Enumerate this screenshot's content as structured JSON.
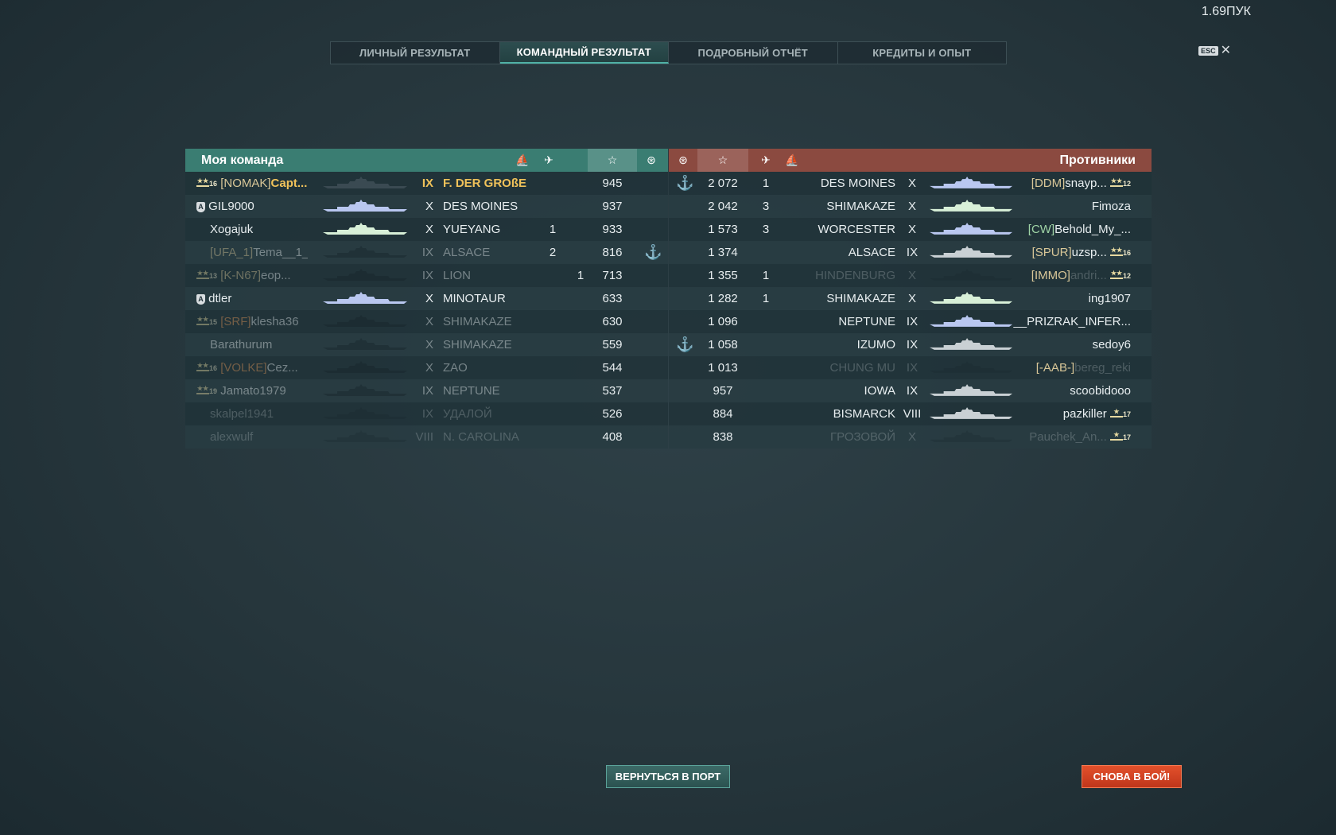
{
  "version": "1.69ПУК",
  "tabs": [
    {
      "label": "ЛИЧНЫЙ РЕЗУЛЬТАТ",
      "active": false
    },
    {
      "label": "КОМАНДНЫЙ РЕЗУЛЬТАТ",
      "active": true
    },
    {
      "label": "ПОДРОБНЫЙ ОТЧЁТ",
      "active": false
    },
    {
      "label": "КРЕДИТЫ И ОПЫТ",
      "active": false
    }
  ],
  "esc": {
    "key": "ESC",
    "close": "✕"
  },
  "my_team": {
    "title": "Моя команда",
    "header_icons": [
      "ship-sunk-icon",
      "aircraft-destroyed-icon",
      "star-icon",
      "base-capture-icon"
    ],
    "rows": [
      {
        "rank": "16",
        "rank_icon": "stripes-2",
        "clan": "[NOMAK]",
        "name": "Capt...",
        "tier": "IX",
        "ship": "F. DER GROßE",
        "planes": "",
        "kills": "",
        "xp": "945",
        "cap": "",
        "highlight": true,
        "state": "alive",
        "ship_color": "#3a4a52"
      },
      {
        "division": "A",
        "clan": "",
        "name": "GIL9000",
        "tier": "X",
        "ship": "DES MOINES",
        "planes": "",
        "kills": "",
        "xp": "937",
        "cap": "",
        "state": "alive",
        "ship_color": "#b9c7f0"
      },
      {
        "clan": "",
        "name": "Xogajuk",
        "tier": "X",
        "ship": "YUEYANG",
        "planes": "1",
        "kills": "",
        "xp": "933",
        "cap": "",
        "state": "alive",
        "ship_color": "#d8f0d8"
      },
      {
        "clan": "[UFA_1]",
        "name": "Tema__1___",
        "tier": "IX",
        "ship": "ALSACE",
        "planes": "2",
        "kills": "",
        "xp": "816",
        "cap": "anchor",
        "state": "dead",
        "ship_color": "#16242a"
      },
      {
        "rank": "13",
        "rank_icon": "stripes-2",
        "clan": "[K-N67]",
        "name": "eop...",
        "tier": "IX",
        "ship": "LION",
        "planes": "",
        "kills": "1",
        "xp": "713",
        "cap": "",
        "state": "dead",
        "ship_color": "#16242a"
      },
      {
        "division": "A",
        "clan": "",
        "name": "dtler",
        "tier": "X",
        "ship": "MINOTAUR",
        "planes": "",
        "kills": "",
        "xp": "633",
        "cap": "",
        "state": "alive",
        "ship_color": "#b9c7f0"
      },
      {
        "rank": "15",
        "rank_icon": "stripes-2",
        "clan": "[SRF]",
        "clan_color": "orange",
        "name": "klesha36",
        "tier": "X",
        "ship": "SHIMAKAZE",
        "planes": "",
        "kills": "",
        "xp": "630",
        "cap": "",
        "state": "dead",
        "ship_color": "#16242a"
      },
      {
        "clan": "",
        "name": "Barathurum",
        "tier": "X",
        "ship": "SHIMAKAZE",
        "planes": "",
        "kills": "",
        "xp": "559",
        "cap": "",
        "state": "dead",
        "ship_color": "#16242a"
      },
      {
        "rank": "16",
        "rank_icon": "stripes-2",
        "clan": "[VOLKE]",
        "clan_color": "orange",
        "name": "Cez...",
        "tier": "X",
        "ship": "ZAO",
        "planes": "",
        "kills": "",
        "xp": "544",
        "cap": "",
        "state": "dead",
        "ship_color": "#16242a"
      },
      {
        "rank": "19",
        "rank_icon": "stripes-2",
        "clan": "",
        "name": "Jamato1979",
        "tier": "IX",
        "ship": "NEPTUNE",
        "planes": "",
        "kills": "",
        "xp": "537",
        "cap": "",
        "state": "dead",
        "ship_color": "#16242a"
      },
      {
        "clan": "",
        "name": "skalpel1941",
        "tier": "IX",
        "ship": "УДАЛОЙ",
        "planes": "",
        "kills": "",
        "xp": "526",
        "cap": "",
        "state": "dead",
        "ship_color": "#16242a"
      },
      {
        "clan": "",
        "name": "alexwulf",
        "tier": "VIII",
        "ship": "N. CAROLINA",
        "planes": "",
        "kills": "",
        "xp": "408",
        "cap": "",
        "state": "dead",
        "ship_color": "#16242a"
      }
    ]
  },
  "enemy_team": {
    "title": "Противники",
    "header_icons": [
      "base-capture-icon",
      "star-icon",
      "aircraft-destroyed-icon",
      "ship-sunk-icon"
    ],
    "rows": [
      {
        "cap": "anchor",
        "xp": "2 072",
        "planes": "",
        "kills": "1",
        "ship": "DES MOINES",
        "tier": "X",
        "clan": "[DDM]",
        "name": "snayp...",
        "rank": "12",
        "rank_icon": "stripes-2",
        "state": "alive",
        "ship_color": "#b9c7f0"
      },
      {
        "cap": "",
        "xp": "2 042",
        "planes": "",
        "kills": "3",
        "ship": "SHIMAKAZE",
        "tier": "X",
        "clan": "",
        "name": "Fimoza",
        "state": "alive",
        "ship_color": "#d8f0d8"
      },
      {
        "cap": "",
        "xp": "1 573",
        "planes": "",
        "kills": "3",
        "ship": "WORCESTER",
        "tier": "X",
        "clan": "[CW]",
        "clan_color": "green",
        "name": "Behold_My_...",
        "state": "alive",
        "ship_color": "#b9c7f0"
      },
      {
        "cap": "",
        "xp": "1 374",
        "planes": "",
        "kills": "",
        "ship": "ALSACE",
        "tier": "IX",
        "clan": "[SPUR]",
        "name": "uzsp...",
        "rank": "16",
        "rank_icon": "stripes-2",
        "state": "alive",
        "ship_color": "#c9d0d4"
      },
      {
        "cap": "",
        "xp": "1 355",
        "planes": "",
        "kills": "1",
        "ship": "HINDENBURG",
        "tier": "X",
        "clan": "[IMMO]",
        "name": "andri...",
        "rank": "12",
        "rank_icon": "stripes-2",
        "state": "dead",
        "ship_color": "#16242a"
      },
      {
        "cap": "",
        "xp": "1 282",
        "planes": "",
        "kills": "1",
        "ship": "SHIMAKAZE",
        "tier": "X",
        "clan": "",
        "name": "ing1907",
        "state": "alive",
        "ship_color": "#d8f0d8"
      },
      {
        "cap": "",
        "xp": "1 096",
        "planes": "",
        "kills": "",
        "ship": "NEPTUNE",
        "tier": "IX",
        "clan": "",
        "name": "__PRIZRAK_INFER...",
        "state": "alive",
        "ship_color": "#b9c7f0"
      },
      {
        "cap": "anchor",
        "xp": "1 058",
        "planes": "",
        "kills": "",
        "ship": "IZUMO",
        "tier": "IX",
        "clan": "",
        "name": "sedoy6",
        "state": "alive",
        "ship_color": "#c9d0d4"
      },
      {
        "cap": "",
        "xp": "1 013",
        "planes": "",
        "kills": "",
        "ship": "CHUNG MU",
        "tier": "IX",
        "clan": "[-AAB-]",
        "name": "bereg_reki",
        "state": "dead",
        "ship_color": "#16242a"
      },
      {
        "cap": "",
        "xp": "957",
        "planes": "",
        "kills": "",
        "ship": "IOWA",
        "tier": "IX",
        "clan": "",
        "name": "scoobidooo",
        "state": "alive",
        "ship_color": "#c9d0d4"
      },
      {
        "cap": "",
        "xp": "884",
        "planes": "",
        "kills": "",
        "ship": "BISMARCK",
        "tier": "VIII",
        "clan": "",
        "name": "pazkiller",
        "rank": "17",
        "rank_icon": "stripes-1",
        "state": "alive",
        "ship_color": "#c9d0d4"
      },
      {
        "cap": "",
        "xp": "838",
        "planes": "",
        "kills": "",
        "ship": "ГРОЗОВОЙ",
        "tier": "X",
        "clan": "",
        "name": "Pauchek_An...",
        "rank": "17",
        "rank_icon": "stripes-1",
        "state": "dead",
        "ship_color": "#16242a"
      }
    ]
  },
  "buttons": {
    "return_port": "ВЕРНУТЬСЯ В ПОРТ",
    "battle_again": "СНОВА В БОЙ!"
  }
}
